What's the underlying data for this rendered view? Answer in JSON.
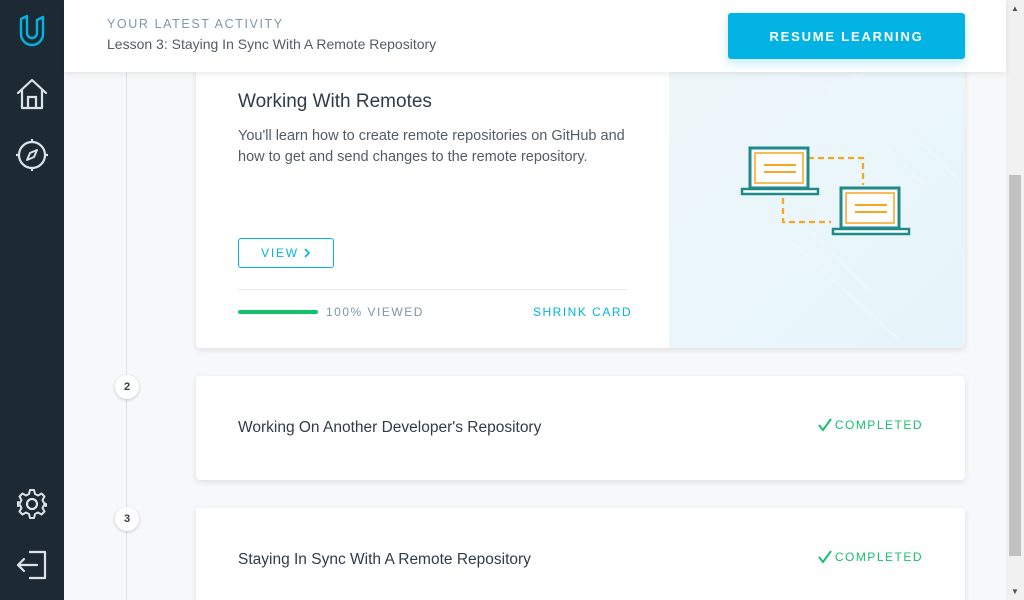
{
  "header": {
    "kicker": "YOUR LATEST ACTIVITY",
    "lesson": "Lesson 3: Staying In Sync With A Remote Repository",
    "resume_label": "RESUME LEARNING"
  },
  "sidebar": {
    "items": [
      {
        "icon": "udacity-logo-icon"
      },
      {
        "icon": "home-icon"
      },
      {
        "icon": "compass-icon"
      },
      {
        "icon": "gear-icon"
      },
      {
        "icon": "logout-icon"
      }
    ]
  },
  "main_card": {
    "title": "Working With Remotes",
    "description": "You'll learn how to create remote repositories on GitHub and how to get and send changes to the remote repository.",
    "view_label": "VIEW",
    "progress_percent": 100,
    "viewed_label": "100% VIEWED",
    "shrink_label": "SHRINK CARD",
    "illustration": "two-laptops-icon"
  },
  "lessons": [
    {
      "number": "2",
      "title": "Working On Another Developer's Repository",
      "status": "COMPLETED"
    },
    {
      "number": "3",
      "title": "Staying In Sync With A Remote Repository",
      "status": "COMPLETED"
    }
  ],
  "colors": {
    "accent": "#02b3e4",
    "success": "#15c26b",
    "sidebar": "#1e2a33",
    "illustration_teal": "#1f8a8a",
    "illustration_orange": "#f5a623"
  }
}
